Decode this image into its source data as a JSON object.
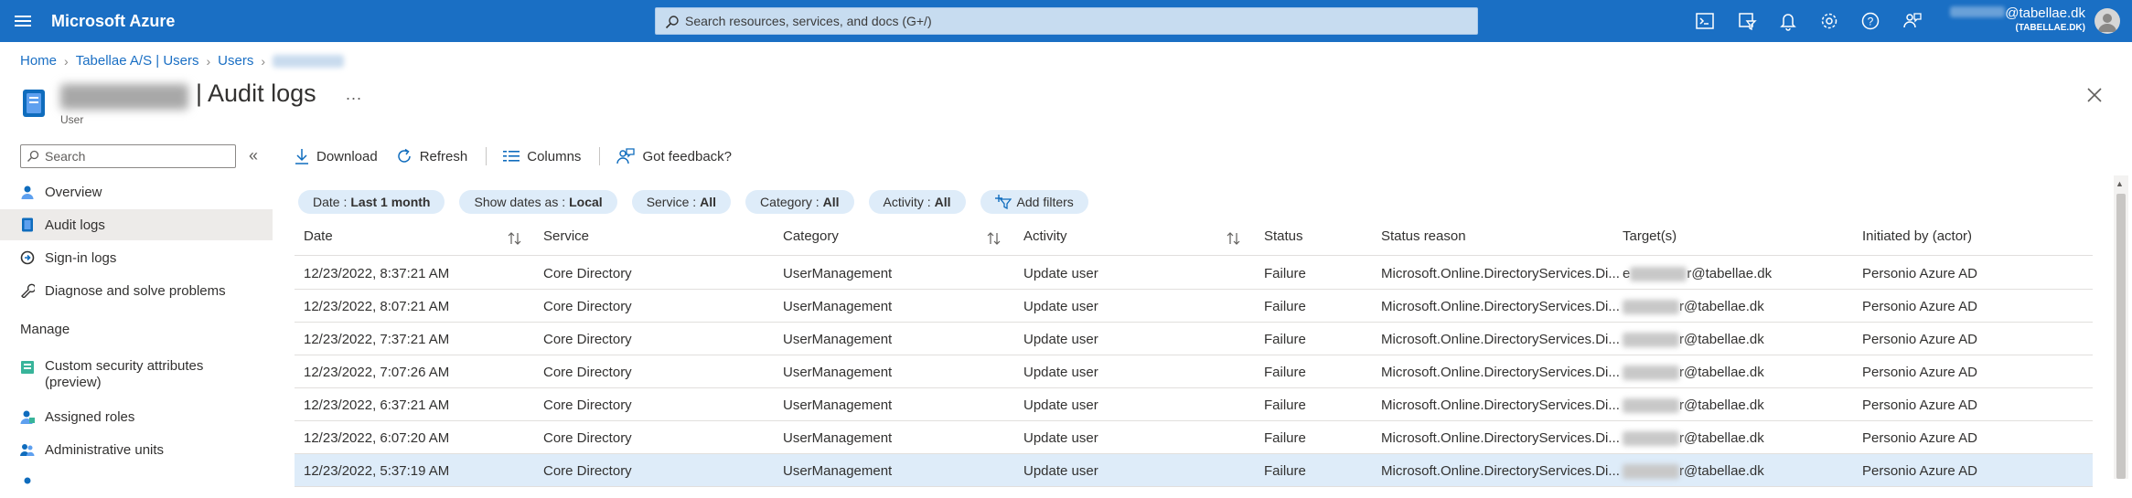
{
  "app": {
    "brand": "Microsoft Azure",
    "search_placeholder": "Search resources, services, and docs (G+/)",
    "account_user": "@tabellae.dk",
    "account_tenant": "TABELLAE.DK",
    "accent": "#1a6fc4"
  },
  "topbar_icons": [
    "cloud-shell-icon",
    "directory-filter-icon",
    "notifications-icon",
    "settings-icon",
    "help-icon",
    "feedback-icon"
  ],
  "breadcrumb": {
    "items": [
      "Home",
      "Tabellae A/S | Users",
      "Users"
    ]
  },
  "header": {
    "title": "| Audit logs",
    "more": "...",
    "subtitle": "User"
  },
  "sidebar": {
    "search_placeholder": "Search",
    "collapse": "«",
    "items": [
      {
        "label": "Overview",
        "icon": "person-icon"
      },
      {
        "label": "Audit logs",
        "icon": "audit-log-icon",
        "selected": true
      },
      {
        "label": "Sign-in logs",
        "icon": "sign-in-icon"
      },
      {
        "label": "Diagnose and solve problems",
        "icon": "wrench-icon"
      }
    ],
    "section_manage": "Manage",
    "manage_items": [
      {
        "label": "Custom security attributes",
        "label2": "(preview)",
        "icon": "security-attributes-icon"
      },
      {
        "label": "Assigned roles",
        "icon": "roles-icon"
      },
      {
        "label": "Administrative units",
        "icon": "admin-units-icon"
      }
    ]
  },
  "toolbar": {
    "download": "Download",
    "refresh": "Refresh",
    "columns": "Columns",
    "feedback": "Got feedback?"
  },
  "filters": [
    {
      "label": "Date :",
      "value": "Last 1 month"
    },
    {
      "label": "Show dates as :",
      "value": "Local"
    },
    {
      "label": "Service :",
      "value": "All"
    },
    {
      "label": "Category :",
      "value": "All"
    },
    {
      "label": "Activity :",
      "value": "All"
    }
  ],
  "add_filters": "Add filters",
  "table": {
    "columns": [
      "Date",
      "Service",
      "Category",
      "Activity",
      "Status",
      "Status reason",
      "Target(s)",
      "Initiated by (actor)"
    ],
    "rows": [
      {
        "date": "12/23/2022, 8:37:21 AM",
        "service": "Core Directory",
        "category": "UserManagement",
        "activity": "Update user",
        "status": "Failure",
        "reason": "Microsoft.Online.DirectoryServices.Di...",
        "target_prefix": "e",
        "target": "r@tabellae.dk",
        "actor": "Personio Azure AD"
      },
      {
        "date": "12/23/2022, 8:07:21 AM",
        "service": "Core Directory",
        "category": "UserManagement",
        "activity": "Update user",
        "status": "Failure",
        "reason": "Microsoft.Online.DirectoryServices.Di...",
        "target_prefix": "",
        "target": "r@tabellae.dk",
        "actor": "Personio Azure AD"
      },
      {
        "date": "12/23/2022, 7:37:21 AM",
        "service": "Core Directory",
        "category": "UserManagement",
        "activity": "Update user",
        "status": "Failure",
        "reason": "Microsoft.Online.DirectoryServices.Di...",
        "target_prefix": "",
        "target": "r@tabellae.dk",
        "actor": "Personio Azure AD"
      },
      {
        "date": "12/23/2022, 7:07:26 AM",
        "service": "Core Directory",
        "category": "UserManagement",
        "activity": "Update user",
        "status": "Failure",
        "reason": "Microsoft.Online.DirectoryServices.Di...",
        "target_prefix": "",
        "target": "r@tabellae.dk",
        "actor": "Personio Azure AD"
      },
      {
        "date": "12/23/2022, 6:37:21 AM",
        "service": "Core Directory",
        "category": "UserManagement",
        "activity": "Update user",
        "status": "Failure",
        "reason": "Microsoft.Online.DirectoryServices.Di...",
        "target_prefix": "",
        "target": "r@tabellae.dk",
        "actor": "Personio Azure AD"
      },
      {
        "date": "12/23/2022, 6:07:20 AM",
        "service": "Core Directory",
        "category": "UserManagement",
        "activity": "Update user",
        "status": "Failure",
        "reason": "Microsoft.Online.DirectoryServices.Di...",
        "target_prefix": "",
        "target": "r@tabellae.dk",
        "actor": "Personio Azure AD"
      },
      {
        "date": "12/23/2022, 5:37:19 AM",
        "service": "Core Directory",
        "category": "UserManagement",
        "activity": "Update user",
        "status": "Failure",
        "reason": "Microsoft.Online.DirectoryServices.Di...",
        "target_prefix": "",
        "target": "r@tabellae.dk",
        "actor": "Personio Azure AD"
      }
    ]
  }
}
